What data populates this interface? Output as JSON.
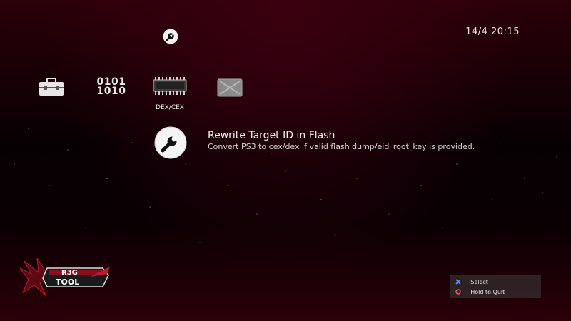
{
  "status": {
    "clock": "14/4 20:15"
  },
  "top_icon": {
    "icon": "wrench-icon"
  },
  "categories": [
    {
      "icon": "toolbox-icon",
      "label": ""
    },
    {
      "icon": "binary-icon",
      "label": "",
      "glyph_lines": [
        "0101",
        "1010"
      ]
    },
    {
      "icon": "chip-icon",
      "label": "DEX/CEX"
    },
    {
      "icon": "folder-icon",
      "label": ""
    }
  ],
  "selected": {
    "icon": "wrench-icon",
    "title": "Rewrite Target ID in Flash",
    "description": "Convert PS3 to cex/dex if valid flash dump/eid_root_key is provided."
  },
  "logo": {
    "text_line1": "R3G",
    "text_line2": "TOOL"
  },
  "hints": [
    {
      "button": "cross",
      "color": "#6f8fff",
      "text": ": Select"
    },
    {
      "button": "circle",
      "color": "#ff5a6e",
      "text": ": Hold to Quit"
    }
  ]
}
